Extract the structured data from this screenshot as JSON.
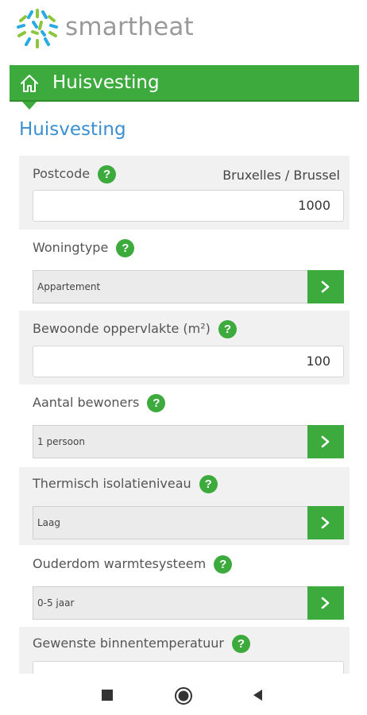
{
  "app": {
    "brand": "smartheat"
  },
  "banner": {
    "title": "Huisvesting",
    "icon": "home-icon"
  },
  "section": {
    "title": "Huisvesting"
  },
  "fields": {
    "postcode": {
      "label": "Postcode",
      "help": "?",
      "side_text": "Bruxelles / Brussel",
      "value": "1000"
    },
    "woningtype": {
      "label": "Woningtype",
      "help": "?",
      "value": "Appartement"
    },
    "oppervlakte": {
      "label": "Bewoonde oppervlakte (m²)",
      "help": "?",
      "value": "100"
    },
    "bewoners": {
      "label": "Aantal bewoners",
      "help": "?",
      "value": "1 persoon"
    },
    "isolatie": {
      "label": "Thermisch isolatieniveau",
      "help": "?",
      "value": "Laag"
    },
    "ouderdom": {
      "label": "Ouderdom warmtesysteem",
      "help": "?",
      "value": "0-5 jaar"
    },
    "temperatuur": {
      "label": "Gewenste binnentemperatuur",
      "help": "?"
    }
  },
  "navigation": {
    "items": [
      "stop-icon",
      "home-circle-icon",
      "back-icon"
    ]
  },
  "colors": {
    "accent": "#3daa3d",
    "title_blue": "#3a8fd0",
    "panel": "#f1f1f1"
  }
}
